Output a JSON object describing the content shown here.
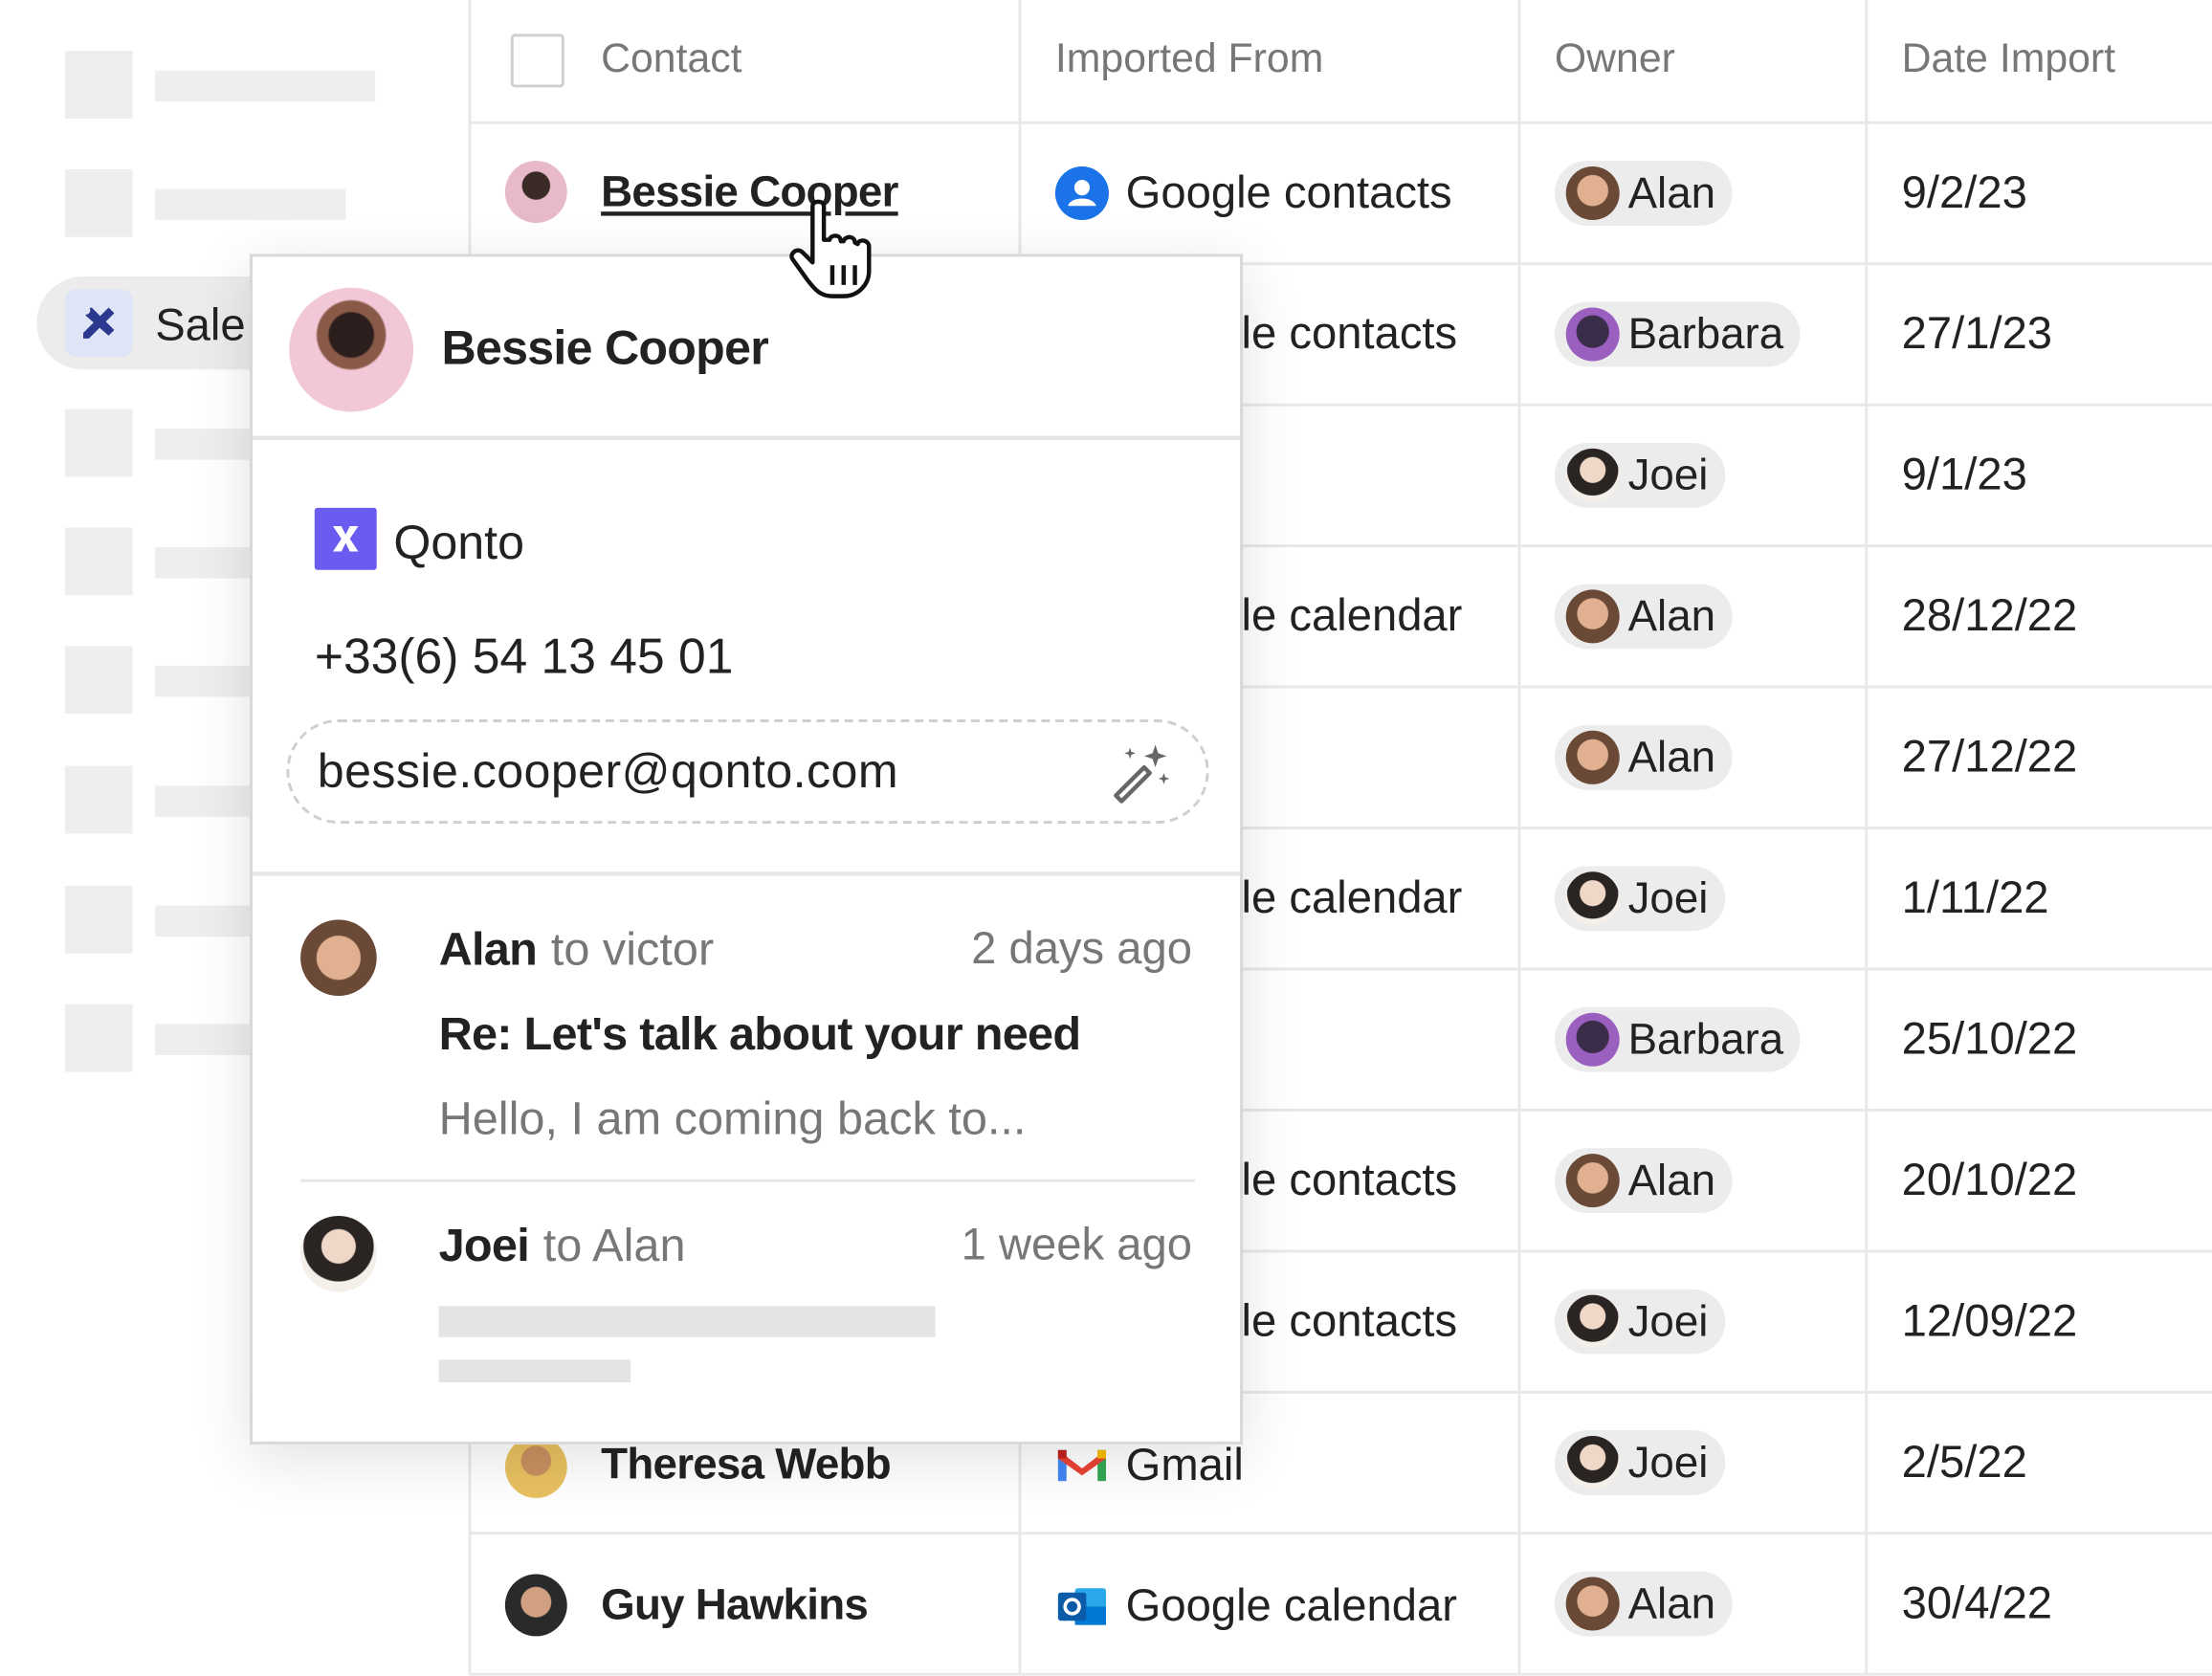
{
  "sidebar": {
    "active_label": "Sale"
  },
  "table": {
    "headers": {
      "contact": "Contact",
      "imported_from": "Imported From",
      "owner": "Owner",
      "date_import": "Date Import"
    },
    "rows": [
      {
        "contact": "Bessie Cooper",
        "source": "Google contacts",
        "source_icon": "google-contacts-icon",
        "owner": "Alan",
        "date": "9/2/23"
      },
      {
        "contact": "",
        "source": "le contacts",
        "source_icon": "",
        "owner": "Barbara",
        "date": "27/1/23"
      },
      {
        "contact": "",
        "source": "",
        "source_icon": "",
        "owner": "Joei",
        "date": "9/1/23"
      },
      {
        "contact": "",
        "source": "le calendar",
        "source_icon": "",
        "owner": "Alan",
        "date": "28/12/22"
      },
      {
        "contact": "",
        "source": "",
        "source_icon": "",
        "owner": "Alan",
        "date": "27/12/22"
      },
      {
        "contact": "",
        "source": "le calendar",
        "source_icon": "",
        "owner": "Joei",
        "date": "1/11/22"
      },
      {
        "contact": "",
        "source": "",
        "source_icon": "",
        "owner": "Barbara",
        "date": "25/10/22"
      },
      {
        "contact": "",
        "source": "le contacts",
        "source_icon": "",
        "owner": "Alan",
        "date": "20/10/22"
      },
      {
        "contact": "",
        "source": "le contacts",
        "source_icon": "",
        "owner": "Joei",
        "date": "12/09/22"
      },
      {
        "contact": "Theresa Webb",
        "source": "Gmail",
        "source_icon": "gmail-icon",
        "owner": "Joei",
        "date": "2/5/22"
      },
      {
        "contact": "Guy Hawkins",
        "source": "Google calendar",
        "source_icon": "outlook-icon",
        "owner": "Alan",
        "date": "30/4/22"
      }
    ]
  },
  "popup": {
    "name": "Bessie Cooper",
    "company": "Qonto",
    "phone": "+33(6) 54 13 45 01",
    "email": "bessie.cooper@qonto.com",
    "messages": [
      {
        "from": "Alan",
        "to": "to victor",
        "time": "2 days ago",
        "subject": "Re: Let's talk about your need",
        "preview": "Hello, I am coming back to..."
      },
      {
        "from": "Joei",
        "to": "to Alan",
        "time": "1 week ago"
      }
    ]
  },
  "colors": {
    "accent": "#6a5cf0",
    "google_blue": "#1a73e8",
    "pill_bg": "#ececec",
    "grid": "#e8e8e8"
  }
}
